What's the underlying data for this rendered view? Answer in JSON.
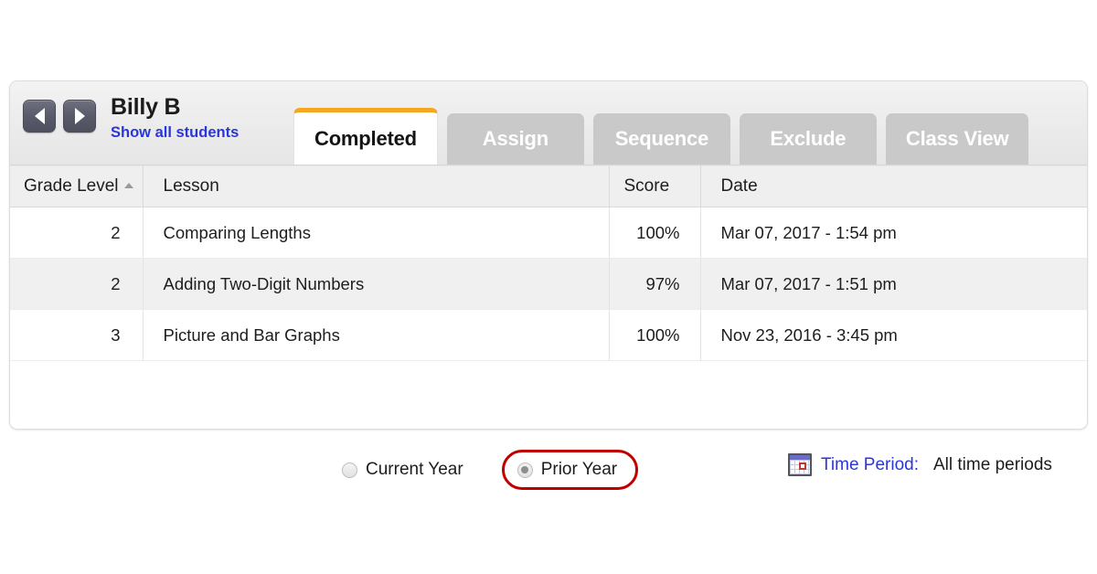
{
  "panel": {
    "student": {
      "name": "Billy B",
      "show_all_link": "Show all students",
      "prev_icon": "chevron-left-icon",
      "next_icon": "chevron-right-icon"
    },
    "tabs": [
      {
        "label": "Completed",
        "active": true
      },
      {
        "label": "Assign",
        "active": false
      },
      {
        "label": "Sequence",
        "active": false
      },
      {
        "label": "Exclude",
        "active": false
      },
      {
        "label": "Class View",
        "active": false
      }
    ],
    "table": {
      "columns": [
        {
          "key": "grade",
          "label": "Grade Level",
          "sorted": true,
          "sort_direction": "ascending"
        },
        {
          "key": "lesson",
          "label": "Lesson",
          "sorted": false
        },
        {
          "key": "score",
          "label": "Score",
          "sorted": false
        },
        {
          "key": "date",
          "label": "Date",
          "sorted": false
        }
      ],
      "rows": [
        {
          "grade": "2",
          "lesson": "Comparing Lengths",
          "score": "100%",
          "date": "Mar 07, 2017 - 1:54 pm"
        },
        {
          "grade": "2",
          "lesson": "Adding Two-Digit Numbers",
          "score": "97%",
          "date": "Mar 07, 2017 - 1:51 pm"
        },
        {
          "grade": "3",
          "lesson": "Picture and Bar Graphs",
          "score": "100%",
          "date": "Nov 23, 2016 - 3:45 pm"
        }
      ]
    }
  },
  "footer": {
    "year_options": [
      {
        "label": "Current Year",
        "selected": false
      },
      {
        "label": "Prior Year",
        "selected": true
      }
    ],
    "time_period": {
      "icon": "calendar-icon",
      "label": "Time Period:",
      "value": "All time periods"
    }
  },
  "colors": {
    "accent_orange": "#f5a623",
    "link_blue": "#2a37d8",
    "highlight_red": "#c00000",
    "tab_gray": "#c9c9c9",
    "row_alt_gray": "#f0f0f0"
  }
}
